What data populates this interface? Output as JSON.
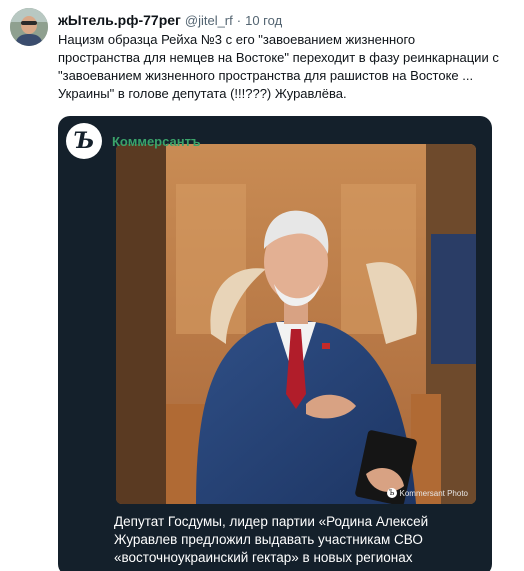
{
  "tweet": {
    "author": {
      "display_name": "жЫтель.рф-77рег",
      "handle": "@jitel_rf",
      "separator": "·",
      "time": "10 год"
    },
    "text_lines": [
      "Нацизм образца Рейха №3 с его \"завоеванием жизненного",
      "пространства для немцев на Востоке\" переходит в фазу реинкарнации с",
      "\"завоеванием жизненного пространства для рашистов на Востоке ...",
      "Украины\" в голове депутата (!!!???) Журавлёва."
    ],
    "card": {
      "source_logo_letter": "Ъ",
      "source_name": "Коммерсантъ",
      "photo_credit": "Kommersant Photo",
      "caption_lines": [
        "Депутат Госдумы, лидер партии «Родина Алексей",
        "Журавлев предложил выдавать участникам СВО",
        "«восточноукраинский гектар» в новых регионах"
      ]
    }
  },
  "colors": {
    "card_background": "#14202b",
    "source_accent": "#3aa36a",
    "secondary_text": "#536471"
  },
  "icons": {
    "avatar": "avatar-photo",
    "photo_credit": "kommersant-logo-icon"
  }
}
